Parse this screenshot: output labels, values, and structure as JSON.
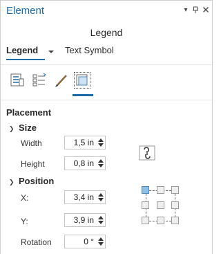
{
  "pane": {
    "title": "Element",
    "element_name": "Legend"
  },
  "tabs": [
    {
      "label": "Legend"
    },
    {
      "label": "Text Symbol"
    }
  ],
  "placement": {
    "section_title": "Placement",
    "size": {
      "group_label": "Size",
      "width_label": "Width",
      "width_value": "1,5 in",
      "height_label": "Height",
      "height_value": "0,8 in"
    },
    "position": {
      "group_label": "Position",
      "x_label": "X:",
      "x_value": "3,4 in",
      "y_label": "Y:",
      "y_value": "3,9 in",
      "rotation_label": "Rotation",
      "rotation_value": "0 °"
    }
  },
  "colors": {
    "accent": "#1c6ba8",
    "anchor_selected": "#8fbfe6"
  },
  "icons": [
    "pin-icon",
    "close-icon",
    "dropdown-menu-icon",
    "chevron-down-icon",
    "options-icon",
    "legend-arrangement-icon",
    "display-icon",
    "placement-icon",
    "lock-aspect-ratio-icon"
  ]
}
